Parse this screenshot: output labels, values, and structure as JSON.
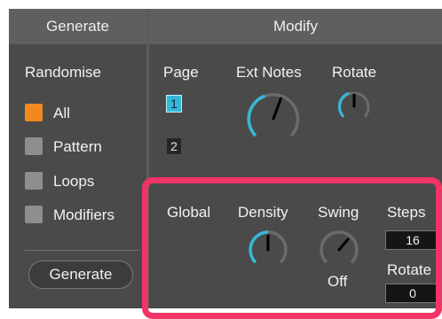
{
  "generate_panel": {
    "header": "Generate",
    "randomise_label": "Randomise",
    "checkboxes": [
      {
        "label": "All",
        "checked": true
      },
      {
        "label": "Pattern",
        "checked": false
      },
      {
        "label": "Loops",
        "checked": false
      },
      {
        "label": "Modifiers",
        "checked": false
      }
    ],
    "generate_button": "Generate"
  },
  "modify_panel": {
    "header": "Modify",
    "page_label": "Page",
    "pages": [
      "1",
      "2"
    ],
    "active_page": "1",
    "ext_notes_label": "Ext Notes",
    "rotate_label": "Rotate"
  },
  "global_section": {
    "global_label": "Global",
    "density_label": "Density",
    "swing_label": "Swing",
    "swing_value": "Off",
    "steps_label": "Steps",
    "steps_value": "16",
    "rotate_label": "Rotate",
    "rotate_value": "0"
  },
  "colors": {
    "accent_orange": "#f3891e",
    "accent_cyan": "#35b8d8",
    "highlight_pink": "#f03466"
  }
}
